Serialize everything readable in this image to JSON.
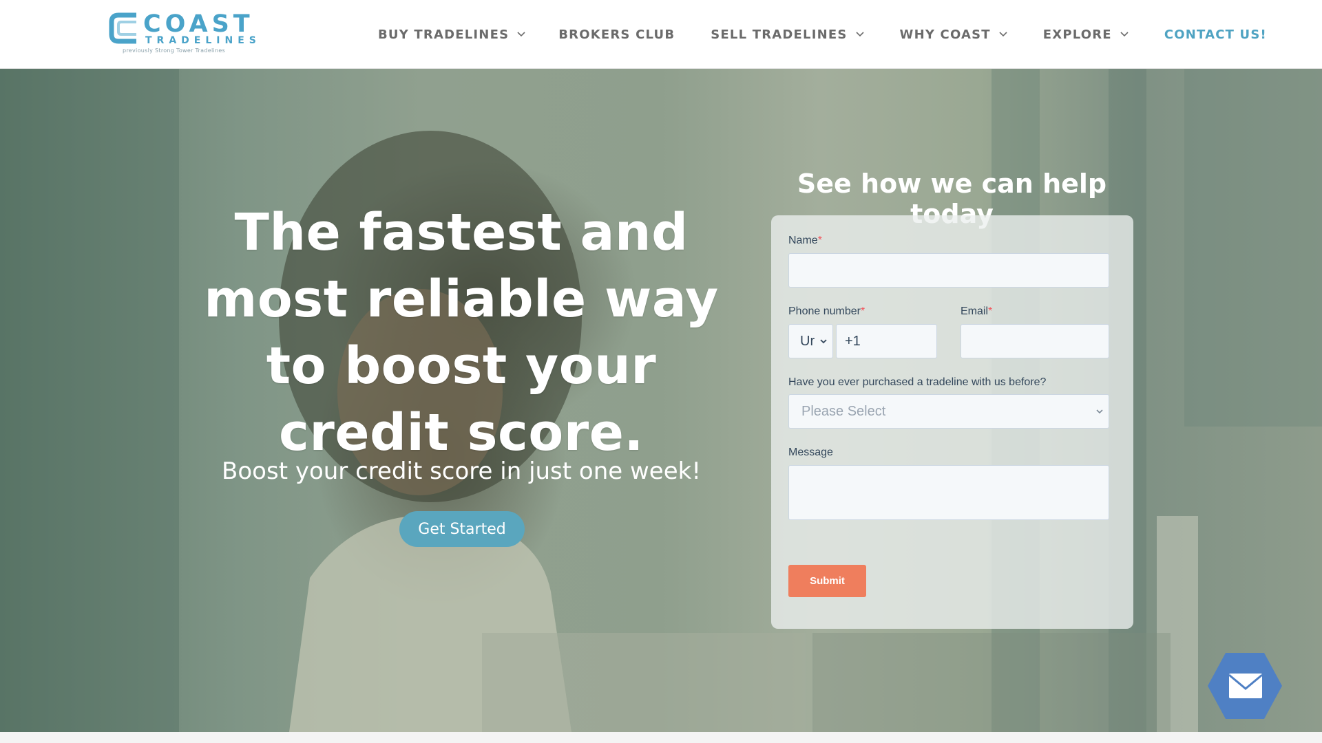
{
  "logo": {
    "word": "COAST",
    "sub": "TRADELINES",
    "tagline": "previously Strong Tower Tradelines"
  },
  "nav": {
    "items": [
      {
        "label": "BUY TRADELINES",
        "has_dropdown": true
      },
      {
        "label": "BROKERS CLUB",
        "has_dropdown": false
      },
      {
        "label": "SELL TRADELINES",
        "has_dropdown": true
      },
      {
        "label": "WHY COAST",
        "has_dropdown": true
      },
      {
        "label": "EXPLORE",
        "has_dropdown": true
      },
      {
        "label": "CONTACT US!",
        "has_dropdown": false
      }
    ]
  },
  "hero": {
    "headline": "The fastest and most reliable way to boost your credit score.",
    "subhead": "Boost your credit score in just one week!",
    "cta_label": "Get Started"
  },
  "form": {
    "title": "See how we can help today",
    "name_label": "Name",
    "name_value": "",
    "phone_label": "Phone number",
    "country_value": "Ur",
    "phone_value": "+1",
    "email_label": "Email",
    "email_value": "",
    "purchased_label": "Have you ever purchased a tradeline with us before?",
    "purchased_value": "Please Select",
    "message_label": "Message",
    "message_value": "",
    "required_mark": "*",
    "submit_label": "Submit"
  },
  "colors": {
    "brand": "#4aa3c9",
    "nav_text": "#6b6b6b",
    "contact": "#4fa3c2",
    "cta": "#5aa6be",
    "submit": "#ef7e5d",
    "chat": "#4f80c4"
  },
  "icons": {
    "chevron": "chevron-down-icon",
    "chat": "envelope-icon"
  }
}
